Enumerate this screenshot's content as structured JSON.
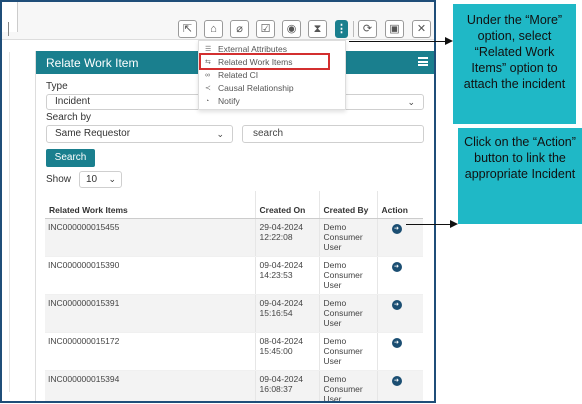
{
  "toolbar": {
    "buttons": [
      {
        "name": "move-icon",
        "glyph": "⇱"
      },
      {
        "name": "tag-icon",
        "glyph": "⌂"
      },
      {
        "name": "attachment-icon",
        "glyph": "⌀"
      },
      {
        "name": "task-icon",
        "glyph": "☑"
      },
      {
        "name": "watch-icon",
        "glyph": "◉"
      },
      {
        "name": "hourglass-icon",
        "glyph": "⧗"
      },
      {
        "name": "more-icon",
        "glyph": "⋮"
      },
      {
        "name": "refresh-icon",
        "glyph": "⟳"
      },
      {
        "name": "save-icon",
        "glyph": "▣"
      },
      {
        "name": "close-icon",
        "glyph": "✕"
      }
    ]
  },
  "more_menu": {
    "items": [
      {
        "label": "External Attributes",
        "icon": "attributes-icon",
        "glyph": "☰"
      },
      {
        "label": "Related Work Items",
        "icon": "related-items-icon",
        "glyph": "⇆"
      },
      {
        "label": "Related CI",
        "icon": "ci-icon",
        "glyph": "∞"
      },
      {
        "label": "Causal Relationship",
        "icon": "share-icon",
        "glyph": "≺"
      },
      {
        "label": "Notify",
        "icon": "notify-icon",
        "glyph": "◔"
      }
    ]
  },
  "modal": {
    "title": "Relate Work Item",
    "type_label": "Type",
    "type_value": "Incident",
    "search_by_label": "Search by",
    "search_by_value": "Same Requestor",
    "search_placeholder": "search",
    "search_button": "Search",
    "show_label": "Show",
    "show_value": "10"
  },
  "table": {
    "headers": {
      "work_item": "Related Work Items",
      "created_on": "Created On",
      "created_by": "Created By",
      "action": "Action"
    },
    "rows": [
      {
        "id": "INC000000015455",
        "date": "29-04-2024",
        "time": "12:22:08",
        "by1": "Demo",
        "by2": "Consumer",
        "by3": "User"
      },
      {
        "id": "INC000000015390",
        "date": "09-04-2024",
        "time": "14:23:53",
        "by1": "Demo",
        "by2": "Consumer",
        "by3": "User"
      },
      {
        "id": "INC000000015391",
        "date": "09-04-2024",
        "time": "15:16:54",
        "by1": "Demo",
        "by2": "Consumer",
        "by3": "User"
      },
      {
        "id": "INC000000015172",
        "date": "08-04-2024",
        "time": "15:45:00",
        "by1": "Demo",
        "by2": "Consumer",
        "by3": "User"
      },
      {
        "id": "INC000000015394",
        "date": "09-04-2024",
        "time": "16:08:37",
        "by1": "Demo",
        "by2": "Consumer",
        "by3": "User"
      }
    ]
  },
  "callouts": {
    "more": "Under the “More” option, select “Related Work Items” option to attach the incident",
    "action": "Click on the “Action” button to link the appropriate Incident"
  },
  "colors": {
    "accent": "#1a7f8e",
    "callout": "#1fb8c6",
    "highlight": "#d32f2f",
    "action_icon": "#1b4e72"
  }
}
